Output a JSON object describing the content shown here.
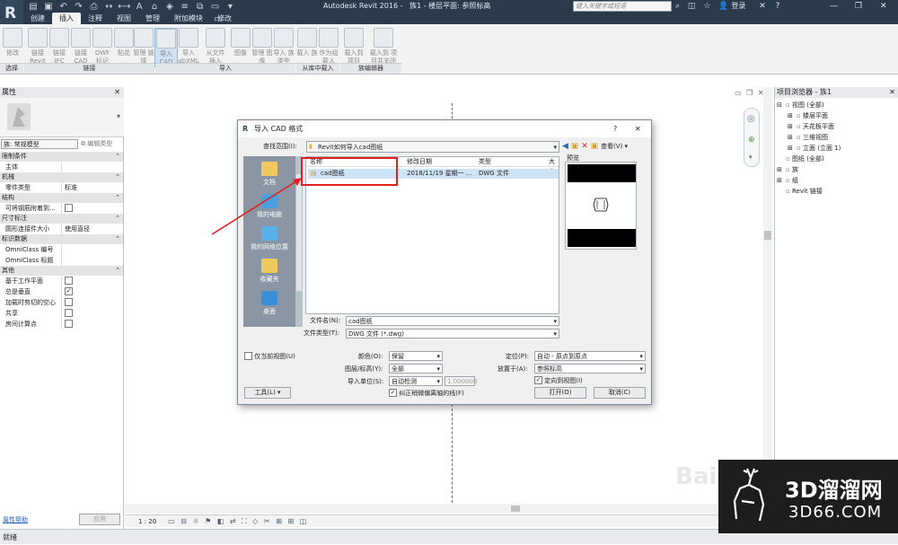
{
  "app": {
    "title": "Autodesk Revit 2016 -",
    "doc_title": "族1 - 楼层平面: 参照标高",
    "search_placeholder": "键入关键字或短语",
    "login": "登录"
  },
  "ribbon": {
    "tabs": [
      "创建",
      "插入",
      "注释",
      "视图",
      "管理",
      "附加模块",
      "修改"
    ],
    "active_tab": "插入",
    "buttons": [
      {
        "label": "修改"
      },
      {
        "label": "链接 Revit"
      },
      {
        "label": "链接 IFC"
      },
      {
        "label": "链接 CAD"
      },
      {
        "label": "DWF 标记"
      },
      {
        "label": "贴花"
      },
      {
        "label": "管理 链接"
      },
      {
        "label": "导入 CAD"
      },
      {
        "label": "导入 gbXML"
      },
      {
        "label": "从文件 插入"
      },
      {
        "label": "图像"
      },
      {
        "label": "管理 图像"
      },
      {
        "label": "导入 族类型"
      },
      {
        "label": "载入 族"
      },
      {
        "label": "作为组 载入"
      },
      {
        "label": "载入到 项目"
      },
      {
        "label": "载入到 项目并关闭"
      }
    ],
    "groups": [
      "选择",
      "链接",
      "导入",
      "从库中载入",
      "族编辑器"
    ]
  },
  "properties": {
    "header": "属性",
    "family_label": "族: 常规模型",
    "edit_type": "编辑类型",
    "sections": [
      {
        "title": "限制条件",
        "rows": [
          {
            "k": "主体",
            "v": ""
          }
        ]
      },
      {
        "title": "机械",
        "rows": [
          {
            "k": "零件类型",
            "v": "标准"
          }
        ]
      },
      {
        "title": "结构",
        "rows": [
          {
            "k": "可将钢筋附着到...",
            "v": "",
            "check": true,
            "checked": false
          }
        ]
      },
      {
        "title": "尺寸标注",
        "rows": [
          {
            "k": "圆形连接件大小",
            "v": "使用直径"
          }
        ]
      },
      {
        "title": "标识数据",
        "rows": [
          {
            "k": "OmniClass 编号",
            "v": ""
          },
          {
            "k": "OmniClass 标题",
            "v": ""
          }
        ]
      },
      {
        "title": "其他",
        "rows": [
          {
            "k": "基于工作平面",
            "v": "",
            "check": true,
            "checked": false
          },
          {
            "k": "总是垂直",
            "v": "",
            "check": true,
            "checked": true
          },
          {
            "k": "加载时剪切的空心",
            "v": "",
            "check": true,
            "checked": false
          },
          {
            "k": "共享",
            "v": "",
            "check": true,
            "checked": false
          },
          {
            "k": "房间计算点",
            "v": "",
            "check": true,
            "checked": false
          }
        ]
      }
    ],
    "help_link": "属性帮助",
    "apply": "应用"
  },
  "browser": {
    "header": "项目浏览器 - 族1",
    "items": [
      {
        "label": "视图 (全部)",
        "indent": 0,
        "sym": "⊟"
      },
      {
        "label": "楼层平面",
        "indent": 1,
        "sym": "⊞"
      },
      {
        "label": "天花板平面",
        "indent": 1,
        "sym": "⊞"
      },
      {
        "label": "三维视图",
        "indent": 1,
        "sym": "⊞"
      },
      {
        "label": "立面 (立面 1)",
        "indent": 1,
        "sym": "⊞"
      },
      {
        "label": "图纸 (全部)",
        "indent": 0,
        "sym": ""
      },
      {
        "label": "族",
        "indent": 0,
        "sym": "⊞"
      },
      {
        "label": "组",
        "indent": 0,
        "sym": "⊞"
      },
      {
        "label": "Revit 链接",
        "indent": 0,
        "sym": ""
      }
    ]
  },
  "dialog": {
    "title": "导入 CAD 格式",
    "look_in_label": "查找范围(I):",
    "look_in_value": "Revit如何导入cad图纸",
    "view_label": "查看(V)",
    "preview_label": "预览",
    "columns": [
      "名称",
      "修改日期",
      "类型",
      "大小"
    ],
    "files": [
      {
        "name": "cad图纸",
        "date": "2018/11/19 星期一 ...",
        "type": "DWG 文件"
      }
    ],
    "places": [
      "文档",
      "我的电脑",
      "我的网络位置",
      "收藏夹",
      "桌面"
    ],
    "file_name_label": "文件名(N):",
    "file_name_value": "cad图纸",
    "file_type_label": "文件类型(T):",
    "file_type_value": "DWG 文件 (*.dwg)",
    "current_view_only": "仅当前视图(U)",
    "colors_label": "颜色(O):",
    "colors_value": "保留",
    "layers_label": "图层/标高(Y):",
    "layers_value": "全部",
    "units_label": "导入单位(S):",
    "units_value": "自动检测",
    "units_scale": "1.000000",
    "correct_lines": "纠正稍微偏离轴的线(F)",
    "positioning_label": "定位(P):",
    "positioning_value": "自动 - 原点到原点",
    "place_at_label": "放置于(A):",
    "place_at_value": "参照标高",
    "orient_to_view": "定向到视图(I)",
    "tools_btn": "工具(L)",
    "open_btn": "打开(O)",
    "cancel_btn": "取消(C)"
  },
  "statusbar": {
    "scale": "1 : 20",
    "status": "就绪"
  },
  "watermark": {
    "brand": "3D溜溜网",
    "url": "3D66.COM",
    "faint": "Bai jing"
  }
}
